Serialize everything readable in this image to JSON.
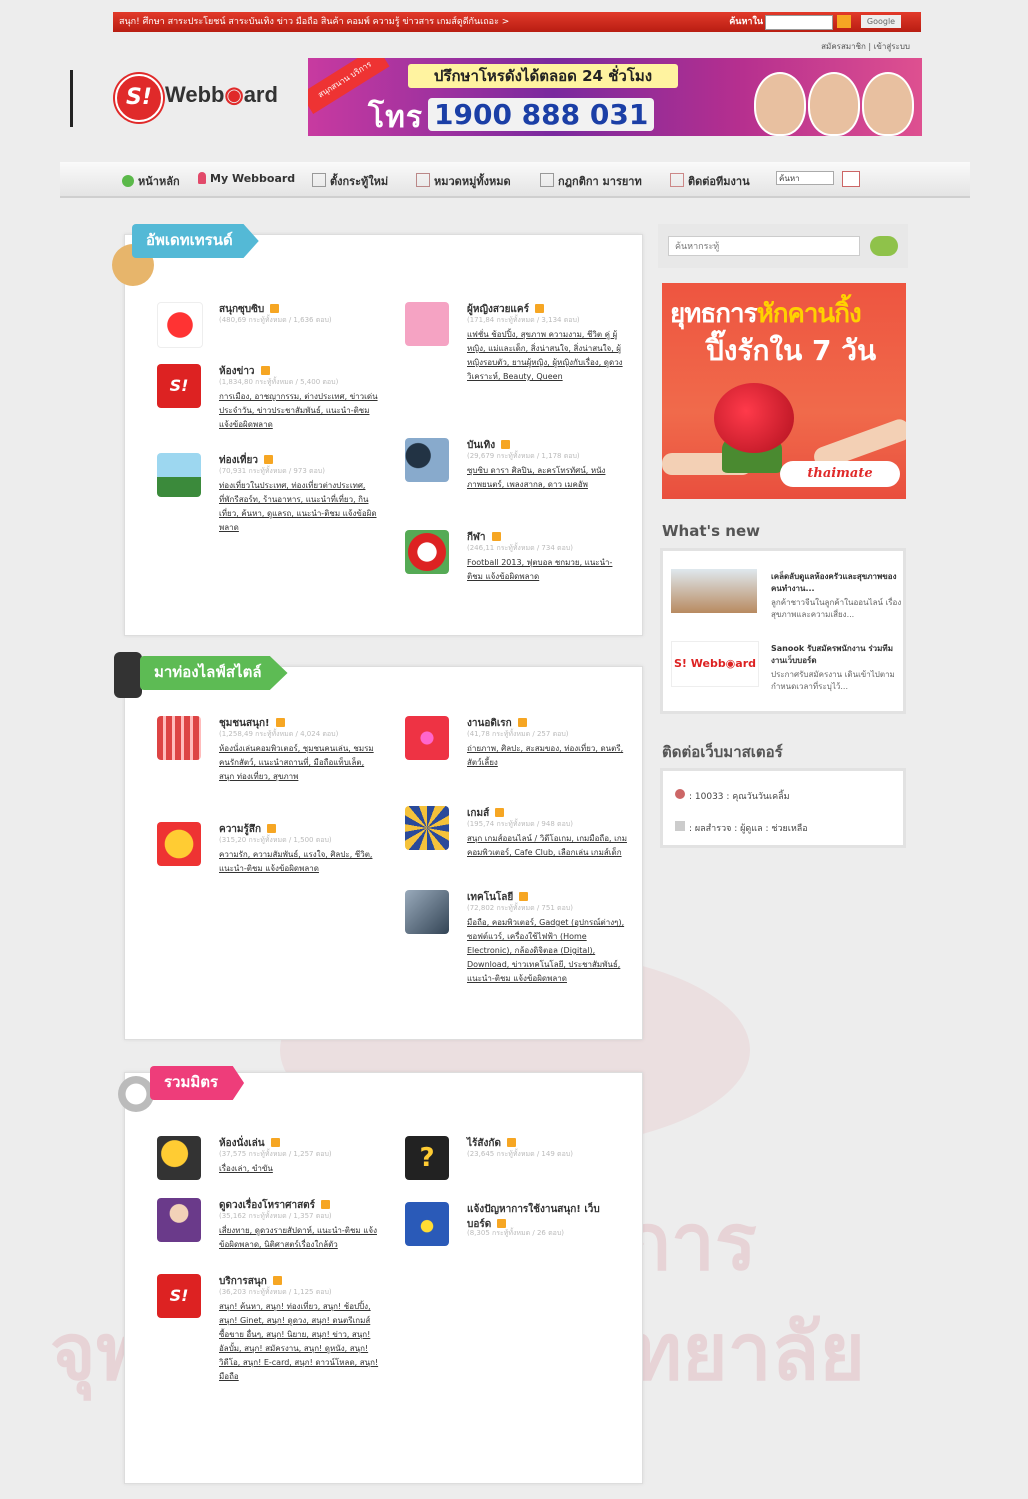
{
  "topbar": {
    "text": "สนุก! ศึกษา สาระประโยชน์ สาระบันเทิง ข่าว มือถือ สินค้า คอมพ์ ความรู้ ข่าวสาร เกมส์ดูดีกันเถอะ >",
    "search_label": "ค้นหาใน",
    "google": "Google"
  },
  "toplinks": "สมัครสมาชิก | เข้าสู่ระบบ",
  "logo": {
    "s": "S!",
    "word_a": "Webb",
    "word_b": "ard"
  },
  "banner": {
    "ribbon": "สนุกสนาน บริการ",
    "line1": "ปรึกษาโหรดังได้ตลอด 24 ชั่วโมง",
    "line2": "โทร",
    "number": "1900 888 031"
  },
  "nav": {
    "items": [
      "หน้าหลัก",
      "My Webboard",
      "ตั้งกระทู้ใหม่",
      "หมวดหมู่ทั้งหมด",
      "กฎกติกา มารยาท",
      "ติดต่อทีมงาน"
    ],
    "search_value": "ค้นหา"
  },
  "sections": [
    {
      "tag": "อัพเดทเทรนด์"
    },
    {
      "tag": "มาท่องไลฟ์สไตล์"
    },
    {
      "tag": "รวมมิตร"
    }
  ],
  "cats": [
    {
      "title": "สนุกซุบซิบ",
      "sub": "(480,69 กระทู้ทั้งหมด / 1,636 ตอบ)",
      "links": ""
    },
    {
      "title": "ผู้หญิงสวยแคร์",
      "sub": "(171,84 กระทู้ทั้งหมด / 3,134 ตอบ)",
      "links": "แฟชั่น ช้อปปิ้ง, สุขภาพ ความงาม, ชีวิต คู่ ผู้หญิง, แม่และเด็ก, สิ่งน่าสนใจ, สิ่งน่าสนใจ, ผู้หญิงรอบตัว, ยานผู้หญิง, ผู้หญิงกับเรื่อง, ดูดวงวิเคราะห์, Beauty, Queen"
    },
    {
      "title": "ห้องข่าว",
      "sub": "(1,834,80 กระทู้ทั้งหมด / 5,400 ตอบ)",
      "links": "การเมือง, อาชญากรรม, ต่างประเทศ, ข่าวเด่นประจำวัน, ข่าวประชาสัมพันธ์, แนะนำ-ติชม แจ้งข้อผิดพลาด"
    },
    {
      "title": "บันเทิง",
      "sub": "(29,679 กระทู้ทั้งหมด / 1,178 ตอบ)",
      "links": "ซุบซิบ ดารา ศิลปิน, ละครโทรทัศน์, หนัง ภาพยนตร์, เพลงสากล, ดาว เมคอัพ"
    },
    {
      "title": "ท่องเที่ยว",
      "sub": "(70,931 กระทู้ทั้งหมด / 973 ตอบ)",
      "links": "ท่องเที่ยวในประเทศ, ท่องเที่ยวต่างประเทศ, ที่พักรีสอร์ท, ร้านอาหาร, แนะนำที่เที่ยว, กินเที่ยว, ค้นหา, ดูแลรถ, แนะนำ-ติชม แจ้งข้อผิดพลาด"
    },
    {
      "title": "กีฬา",
      "sub": "(246,11 กระทู้ทั้งหมด / 734 ตอบ)",
      "links": "Football 2013, ฟุตบอล ชกมวย, แนะนำ-ติชม แจ้งข้อผิดพลาด"
    },
    {
      "title": "ชุมชนสนุก!",
      "sub": "(1,258,49 กระทู้ทั้งหมด / 4,024 ตอบ)",
      "links": "ห้องนั่งเล่นคอมพิวเตอร์, ชุมชนคนเล่น, ชมรมคนรักสัตว์, แนะนำสถานที่, มือถือแท็บเล็ต, สนุก ท่องเที่ยว, สุขภาพ"
    },
    {
      "title": "งานอดิเรก",
      "sub": "(41,78 กระทู้ทั้งหมด / 257 ตอบ)",
      "links": "ถ่ายภาพ, ศิลปะ, สะสมของ, ท่องเที่ยว, ดนตรี, สัตว์เลี้ยง"
    },
    {
      "title": "ความรู้สึก",
      "sub": "(315,20 กระทู้ทั้งหมด / 1,500 ตอบ)",
      "links": "ความรัก, ความสัมพันธ์, แรงใจ, ศิลปะ, ชีวิต, แนะนำ-ติชม แจ้งข้อผิดพลาด"
    },
    {
      "title": "เกมส์",
      "sub": "(195,74 กระทู้ทั้งหมด / 948 ตอบ)",
      "links": "สนุก เกมส์ออนไลน์ / วิดีโอเกม, เกมมือถือ, เกมคอมพิวเตอร์, Cafe Club, เลือกเล่น เกมส์เด็ก"
    },
    {
      "title": "เทคโนโลยี",
      "sub": "(72,802 กระทู้ทั้งหมด / 751 ตอบ)",
      "links": "มือถือ, คอมพิวเตอร์, Gadget (อุปกรณ์ต่างๆ), ซอฟต์แวร์, เครื่องใช้ไฟฟ้า (Home Electronic), กล้องดิจิตอล (Digital), Download, ข่าวเทคโนโลยี, ประชาสัมพันธ์, แนะนำ-ติชม แจ้งข้อผิดพลาด"
    },
    {
      "title": "ห้องนั่งเล่น",
      "sub": "(37,575 กระทู้ทั้งหมด / 1,257 ตอบ)",
      "links": "เรื่องเล่า, ขำขัน"
    },
    {
      "title": "ไร้สังกัด",
      "sub": "(23,645 กระทู้ทั้งหมด / 149 ตอบ)",
      "links": ""
    },
    {
      "title": "ดูดวงเรื่องโหราศาสตร์",
      "sub": "(35,162 กระทู้ทั้งหมด / 1,357 ตอบ)",
      "links": "เสี่ยงทาย, ดูดวงรายสัปดาห์, แนะนำ-ติชม แจ้งข้อผิดพลาด, นิติศาสตร์เรื่องใกล้ตัว"
    },
    {
      "title": "แจ้งปัญหาการใช้งานสนุก! เว็บบอร์ด",
      "sub": "(8,305 กระทู้ทั้งหมด / 26 ตอบ)",
      "links": ""
    },
    {
      "title": "บริการสนุก",
      "sub": "(36,203 กระทู้ทั้งหมด / 1,125 ตอบ)",
      "links": "สนุก! ค้นหา, สนุก! ท่องเที่ยว, สนุก! ช้อปปิ้ง, สนุก! Ginet, สนุก! ดูดวง, สนุก! ดนตรีเกมส์ ซื้อขาย อื่นๆ, สนุก! นิยาย, สนุก! ข่าว, สนุก! อัลบั้ม, สนุก! สมัครงาน, สนุก! ดูหนัง, สนุก! วิดีโอ, สนุก! E-card, สนุก! ดาวน์โหลด, สนุก! มือถือ"
    }
  ],
  "right": {
    "search_placeholder": "ค้นหากระทู้",
    "ad_line1a": "ยุทธการ",
    "ad_line1b": "หักคานกิ้ง",
    "ad_line2": "ปิ๊งรักใน 7 วัน",
    "ad_brand": "thaimate",
    "whats_new": "What's new",
    "news": [
      {
        "head": "เคล็ดลับดูแลห้องครัวและสุขภาพของคนทำงาน...",
        "body": "ลูกค้าชาวจีนในลูกค้าในออนไลน์ เรื่องสุขภาพและความเสี่ยง..."
      },
      {
        "head": "Sanook รับสมัครพนักงาน ร่วมทีมงานเว็บบอร์ด",
        "body": "ประกาศรับสมัครงาน เดินเข้าไปตามกำหนดเวลาที่ระบุไว้..."
      }
    ],
    "contact_head": "ติดต่อเว็บมาสเตอร์",
    "contact_row1": ": 10033  : คุณวันวันเคลิ้ม",
    "contact_row2": ": ผลสำรวจ  : ผู้ดูแล  : ช่วยเหลือ"
  },
  "watermark": {
    "line1": "สถาบันวิทยบริการ",
    "line2": "จุฬาลงกรณ์มหาวิทยาลัย"
  }
}
